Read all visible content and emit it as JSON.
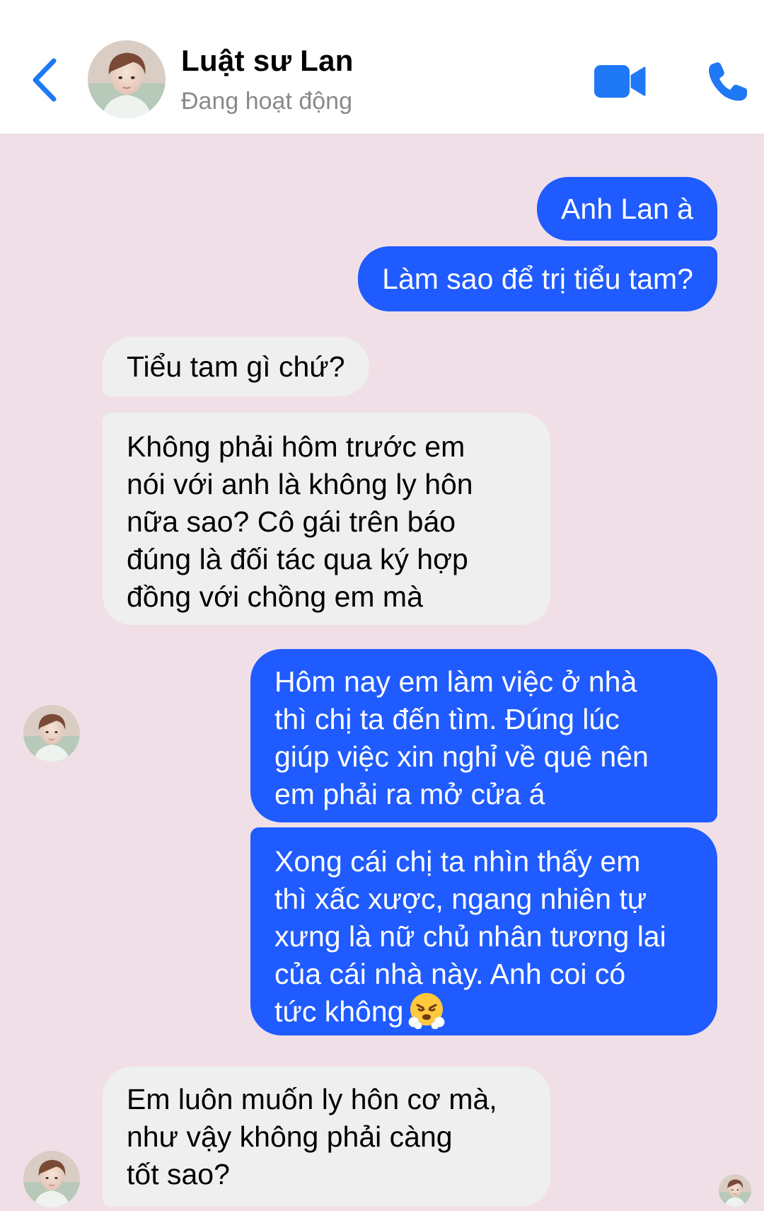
{
  "header": {
    "contact_name": "Luật sư Lan",
    "status": "Đang hoạt động",
    "back_icon": "chevron-left-icon",
    "video_icon": "video-camera-icon",
    "phone_icon": "phone-icon",
    "accent_color": "#1f78f5"
  },
  "messages": [
    {
      "sender": "me",
      "lines": [
        "Anh Lan à"
      ]
    },
    {
      "sender": "me",
      "lines": [
        "Làm sao để trị tiểu tam?"
      ]
    },
    {
      "sender": "contact",
      "lines": [
        "Tiểu tam gì chứ?"
      ]
    },
    {
      "sender": "contact",
      "lines": [
        "Không phải hôm trước em",
        "nói với anh là không ly hôn",
        "nữa sao? Cô gái trên báo",
        "đúng là đối tác qua ký hợp",
        "đồng với chồng em mà"
      ]
    },
    {
      "sender": "me",
      "lines": [
        "Hôm nay em làm việc ở nhà",
        "thì chị ta đến tìm. Đúng lúc",
        "giúp việc xin nghỉ về quê nên",
        "em phải ra mở cửa á"
      ]
    },
    {
      "sender": "me",
      "lines": [
        "Xong cái chị ta nhìn thấy em",
        "thì xấc xược, ngang nhiên tự",
        "xưng là nữ chủ nhân tương lai",
        "của cái nhà này. Anh coi có",
        "tức không"
      ],
      "emoji": "face-with-steam-emoji"
    },
    {
      "sender": "contact",
      "lines": [
        "Em luôn muốn ly hôn cơ mà,",
        "như vậy không phải càng",
        "tốt sao?"
      ]
    }
  ],
  "colors": {
    "outgoing_bubble": "#1f5bff",
    "incoming_bubble": "#efefef",
    "chat_background": "#f1dfe8"
  }
}
